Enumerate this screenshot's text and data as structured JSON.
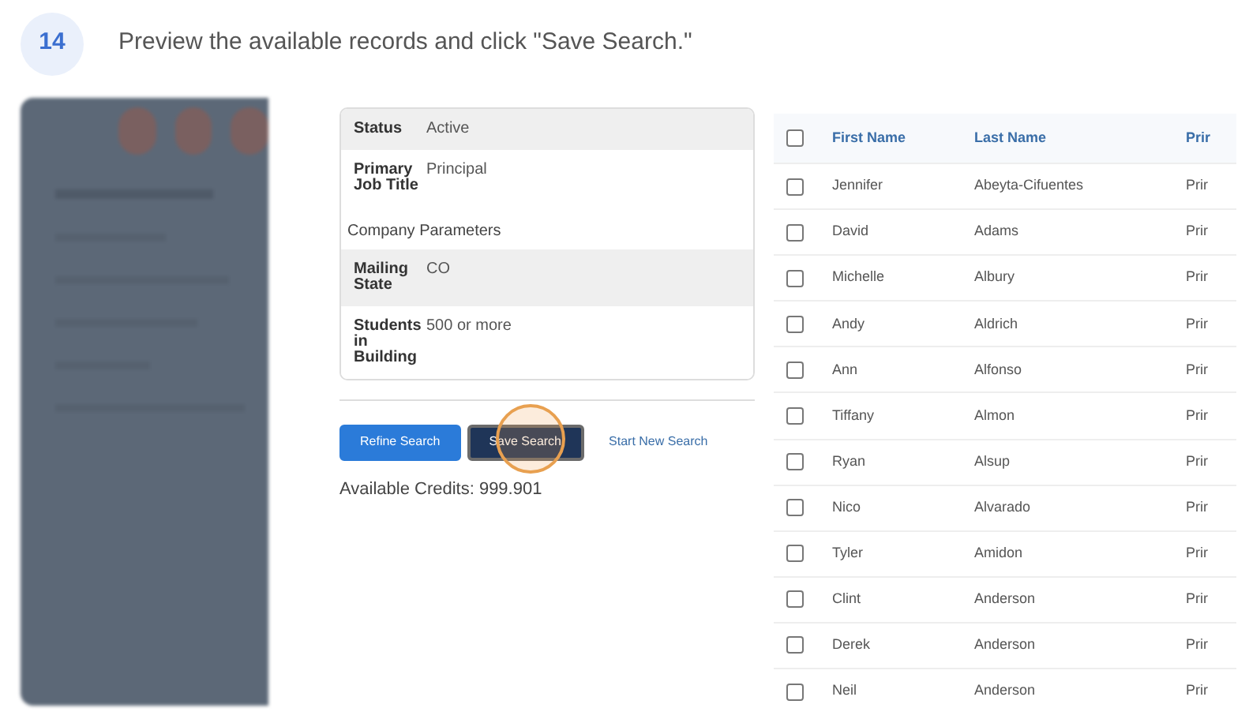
{
  "step": {
    "number": "14",
    "instruction": "Preview the available records and click \"Save Search.\""
  },
  "parameters": {
    "rows": [
      {
        "kind": "field",
        "label": "Status",
        "value": "Active",
        "shaded": true
      },
      {
        "kind": "field",
        "label": "Primary Job Title",
        "value": "Principal",
        "shaded": false
      },
      {
        "kind": "heading",
        "label": "Company Parameters"
      },
      {
        "kind": "field",
        "label": "Mailing State",
        "value": "CO",
        "shaded": true
      },
      {
        "kind": "field",
        "label": "Students in Building",
        "value": "500 or more",
        "shaded": false
      }
    ]
  },
  "actions": [
    {
      "kind": "primary",
      "label": "Refine Search",
      "highlighted": false
    },
    {
      "kind": "dark",
      "label": "Save Search",
      "highlighted": true
    },
    {
      "kind": "link",
      "label": "Start New Search",
      "highlighted": false
    }
  ],
  "credits": "Available Credits: 999.901",
  "table": {
    "select_all": {
      "checked": false
    },
    "columns": [
      "First Name",
      "Last Name",
      "Prir"
    ],
    "rows": [
      {
        "checked": false,
        "cells": [
          "Jennifer",
          "Abeyta-Cifuentes",
          "Prir"
        ]
      },
      {
        "checked": false,
        "cells": [
          "David",
          "Adams",
          "Prir"
        ]
      },
      {
        "checked": false,
        "cells": [
          "Michelle",
          "Albury",
          "Prir"
        ]
      },
      {
        "checked": false,
        "cells": [
          "Andy",
          "Aldrich",
          "Prir"
        ]
      },
      {
        "checked": false,
        "cells": [
          "Ann",
          "Alfonso",
          "Prir"
        ]
      },
      {
        "checked": false,
        "cells": [
          "Tiffany",
          "Almon",
          "Prir"
        ]
      },
      {
        "checked": false,
        "cells": [
          "Ryan",
          "Alsup",
          "Prir"
        ]
      },
      {
        "checked": false,
        "cells": [
          "Nico",
          "Alvarado",
          "Prir"
        ]
      },
      {
        "checked": false,
        "cells": [
          "Tyler",
          "Amidon",
          "Prir"
        ]
      },
      {
        "checked": false,
        "cells": [
          "Clint",
          "Anderson",
          "Prir"
        ]
      },
      {
        "checked": false,
        "cells": [
          "Derek",
          "Anderson",
          "Prir"
        ]
      },
      {
        "checked": false,
        "cells": [
          "Neil",
          "Anderson",
          "Prir"
        ]
      }
    ]
  }
}
